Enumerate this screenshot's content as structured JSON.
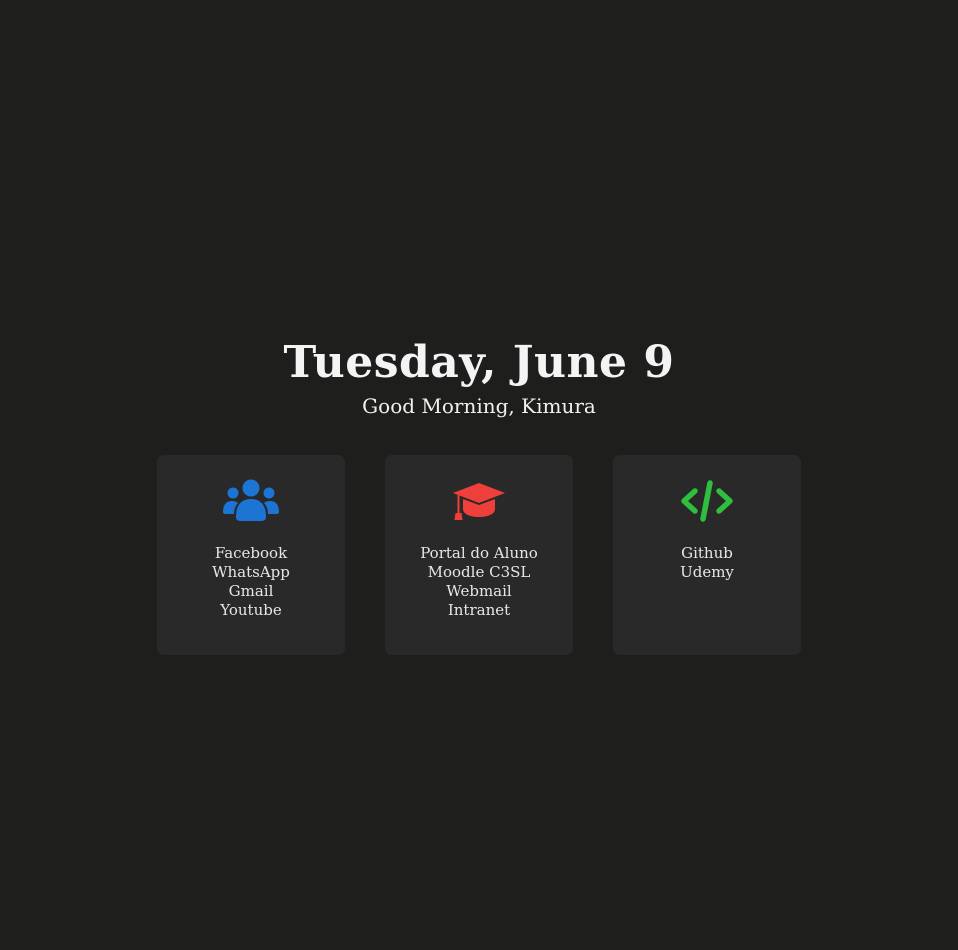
{
  "header": {
    "date": "Tuesday, June 9",
    "greeting": "Good Morning, Kimura"
  },
  "cards": [
    {
      "icon": "users-icon",
      "icon_color": "#1c74d4",
      "links": [
        "Facebook",
        "WhatsApp",
        "Gmail",
        "Youtube"
      ]
    },
    {
      "icon": "graduation-cap-icon",
      "icon_color": "#ef3f3a",
      "links": [
        "Portal do Aluno",
        "Moodle C3SL",
        "Webmail",
        "Intranet"
      ]
    },
    {
      "icon": "code-icon",
      "icon_color": "#2fbf3f",
      "links": [
        "Github",
        "Udemy"
      ]
    }
  ],
  "colors": {
    "background": "#1e1e1d",
    "card": "#292929",
    "text": "#f2f2f2"
  }
}
